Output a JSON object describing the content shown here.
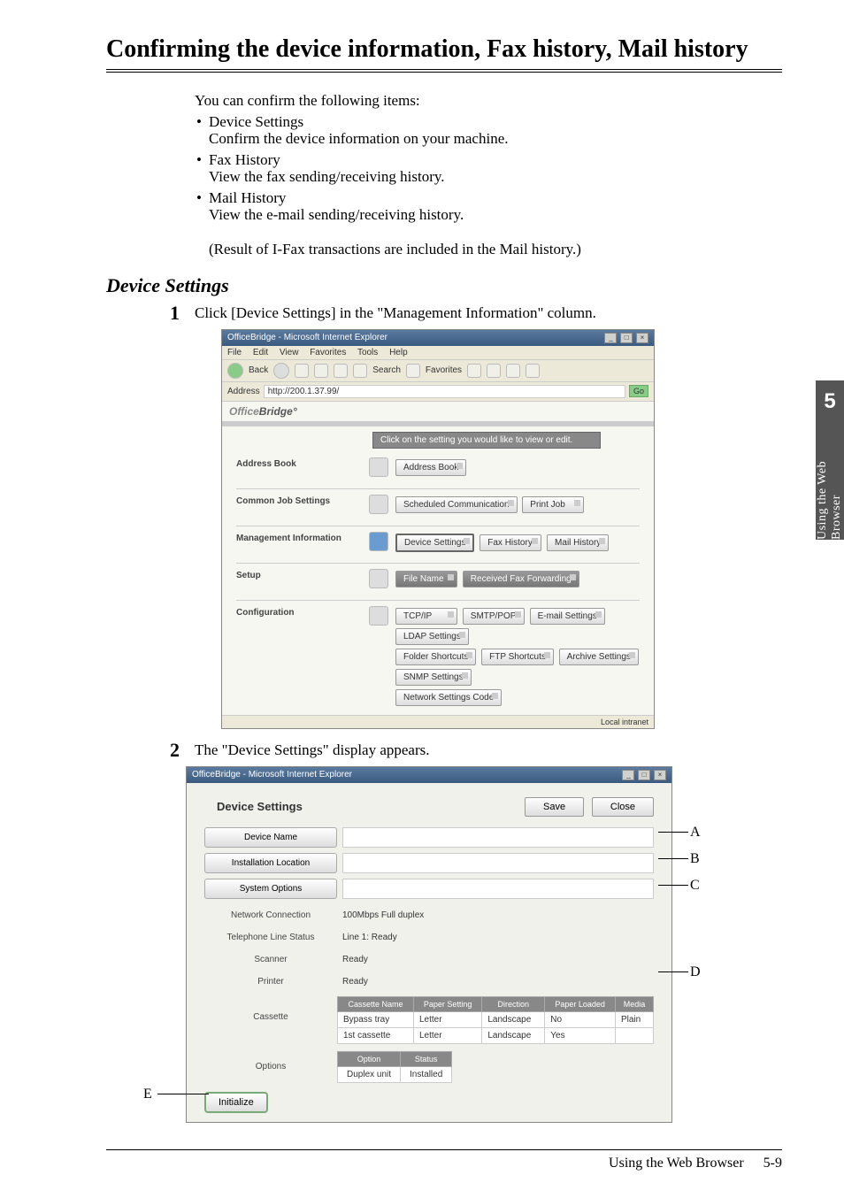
{
  "heading": "Confirming the device information, Fax history, Mail history",
  "intro_lead": "You can confirm the following items:",
  "intro_items": [
    {
      "title": "Device Settings",
      "desc": "Confirm the device information on your machine."
    },
    {
      "title": "Fax History",
      "desc": "View the fax sending/receiving history."
    },
    {
      "title": "Mail History",
      "desc": "View the e-mail sending/receiving history.",
      "desc2": "(Result of I-Fax transactions are included in the Mail history.)"
    }
  ],
  "section_heading": "Device Settings",
  "step1_num": "1",
  "step1_text": "Click [Device Settings] in the \"Management Information\" column.",
  "step2_num": "2",
  "step2_text": "The \"Device Settings\" display appears.",
  "side_tab": {
    "num": "5",
    "text": "Using the Web Browser"
  },
  "footer": {
    "text": "Using the Web Browser",
    "page": "5-9"
  },
  "shot1": {
    "title": "OfficeBridge - Microsoft Internet Explorer",
    "menus": [
      "File",
      "Edit",
      "View",
      "Favorites",
      "Tools",
      "Help"
    ],
    "back": "Back",
    "search": "Search",
    "favorites_btn": "Favorites",
    "address_label": "Address",
    "address_value": "http://200.1.37.99/",
    "go": "Go",
    "logo1": "Office",
    "logo2": "Bridge",
    "message": "Click on the setting you would like to view or edit.",
    "sections": {
      "address_book": {
        "label": "Address Book",
        "buttons": [
          "Address Book"
        ]
      },
      "common_job": {
        "label": "Common Job Settings",
        "buttons": [
          "Scheduled Communication",
          "Print Job"
        ]
      },
      "mgmt_info": {
        "label": "Management Information",
        "buttons": [
          "Device Settings",
          "Fax History",
          "Mail History"
        ]
      },
      "setup": {
        "label": "Setup",
        "buttons": [
          "File Name",
          "Received Fax Forwarding"
        ]
      },
      "config": {
        "label": "Configuration",
        "rows": [
          [
            "TCP/IP",
            "SMTP/POP",
            "E-mail Settings",
            "LDAP Settings"
          ],
          [
            "Folder Shortcuts",
            "FTP Shortcuts",
            "Archive Settings",
            "SNMP Settings"
          ],
          [
            "Network Settings Code"
          ]
        ]
      }
    },
    "status_right": "Local intranet"
  },
  "shot2": {
    "window_title": "OfficeBridge - Microsoft Internet Explorer",
    "title": "Device Settings",
    "save": "Save",
    "close": "Close",
    "rows_boxed": [
      {
        "label": "Device Name",
        "value": ""
      },
      {
        "label": "Installation Location",
        "value": ""
      },
      {
        "label": "System Options",
        "value": ""
      }
    ],
    "rows_plain": [
      {
        "label": "Network Connection",
        "value": "100Mbps Full duplex"
      },
      {
        "label": "Telephone Line Status",
        "value": "Line 1: Ready"
      },
      {
        "label": "Scanner",
        "value": "Ready"
      },
      {
        "label": "Printer",
        "value": "Ready"
      }
    ],
    "cassette": {
      "label": "Cassette",
      "headers": [
        "Cassette Name",
        "Paper Setting",
        "Direction",
        "Paper Loaded",
        "Media"
      ],
      "rows": [
        [
          "Bypass tray",
          "Letter",
          "Landscape",
          "No",
          "Plain"
        ],
        [
          "1st cassette",
          "Letter",
          "Landscape",
          "Yes",
          ""
        ]
      ]
    },
    "options": {
      "label": "Options",
      "headers": [
        "Option",
        "Status"
      ],
      "rows": [
        [
          "Duplex unit",
          "Installed"
        ]
      ]
    },
    "initialize": "Initialize"
  },
  "callouts": {
    "A": "A",
    "B": "B",
    "C": "C",
    "D": "D",
    "E": "E"
  }
}
